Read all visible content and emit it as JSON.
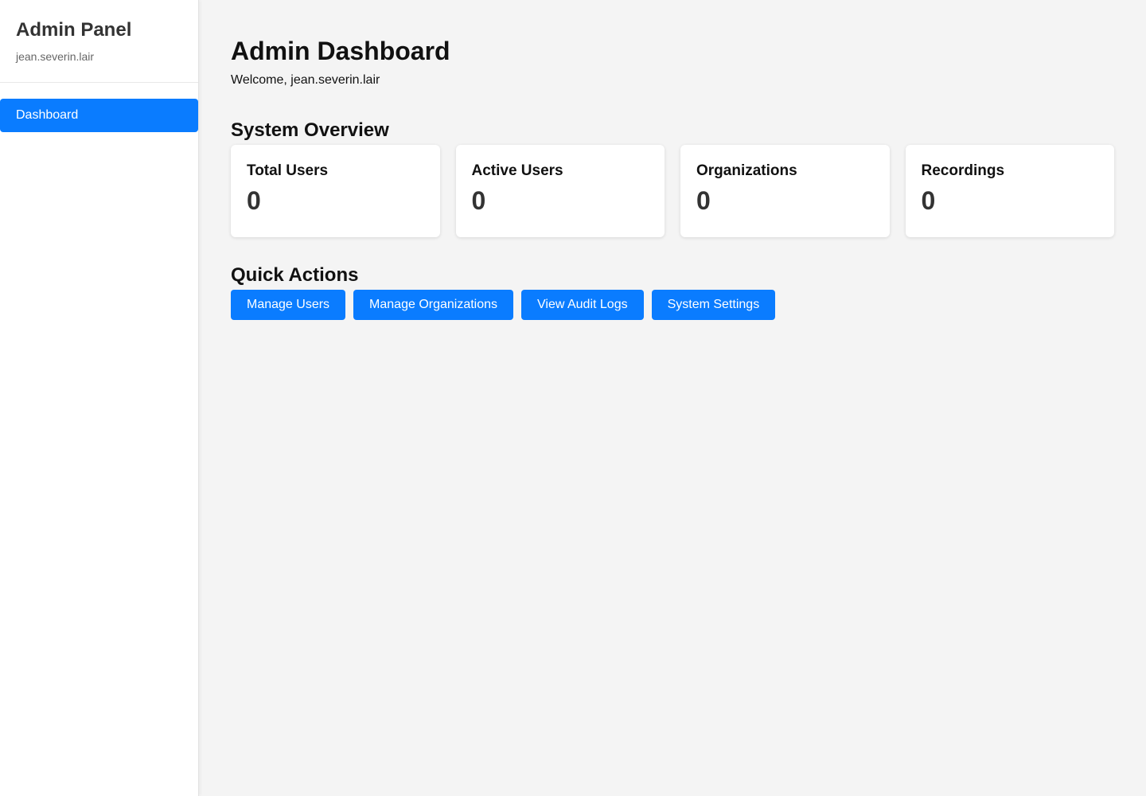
{
  "sidebar": {
    "title": "Admin Panel",
    "username": "jean.severin.lair",
    "items": [
      {
        "label": "Dashboard",
        "active": true
      }
    ]
  },
  "main": {
    "title": "Admin Dashboard",
    "welcome": "Welcome, jean.severin.lair",
    "overview": {
      "title": "System Overview",
      "cards": [
        {
          "label": "Total Users",
          "value": "0"
        },
        {
          "label": "Active Users",
          "value": "0"
        },
        {
          "label": "Organizations",
          "value": "0"
        },
        {
          "label": "Recordings",
          "value": "0"
        }
      ]
    },
    "quick_actions": {
      "title": "Quick Actions",
      "buttons": [
        {
          "label": "Manage Users"
        },
        {
          "label": "Manage Organizations"
        },
        {
          "label": "View Audit Logs"
        },
        {
          "label": "System Settings"
        }
      ]
    }
  },
  "colors": {
    "accent": "#0a7cff",
    "background": "#f4f4f4",
    "sidebar_bg": "#ffffff"
  }
}
